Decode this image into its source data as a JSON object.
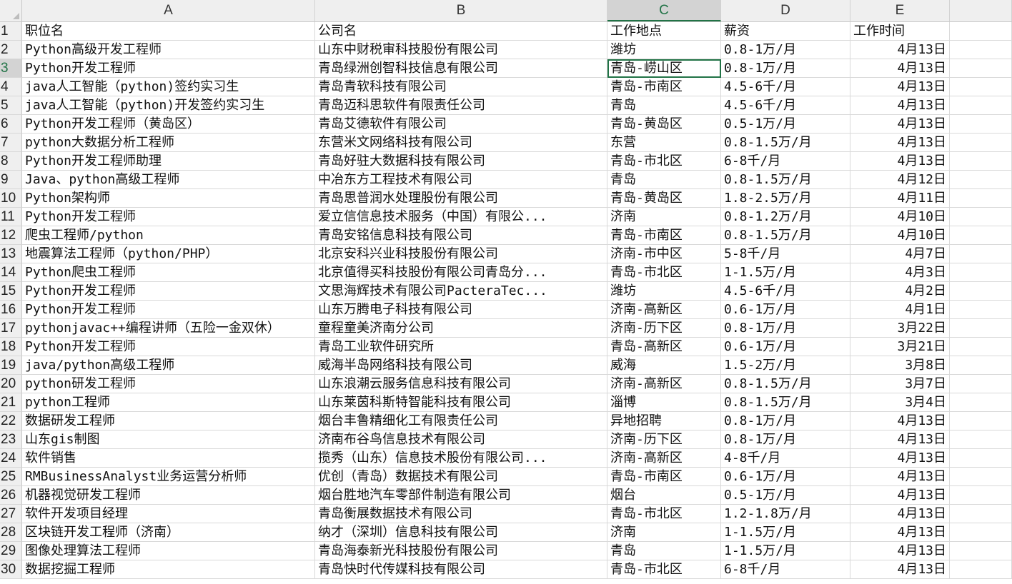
{
  "columns": [
    "A",
    "B",
    "C",
    "D",
    "E",
    ""
  ],
  "selected_column": 2,
  "active_cell": {
    "row": 3,
    "col": 2
  },
  "rows": [
    [
      "职位名",
      "公司名",
      "工作地点",
      "薪资",
      "工作时间"
    ],
    [
      "Python高级开发工程师",
      "山东中财税审科技股份有限公司",
      "潍坊",
      "0.8-1万/月",
      "4月13日"
    ],
    [
      "Python开发工程师",
      "青岛绿洲创智科技信息有限公司",
      "青岛-崂山区",
      "0.8-1万/月",
      "4月13日"
    ],
    [
      "java人工智能（python)签约实习生",
      "青岛青软科技有限公司",
      "青岛-市南区",
      "4.5-6千/月",
      "4月13日"
    ],
    [
      "java人工智能（python)开发签约实习生",
      "青岛迈科思软件有限责任公司",
      "青岛",
      "4.5-6千/月",
      "4月13日"
    ],
    [
      "Python开发工程师（黄岛区）",
      "青岛艾德软件有限公司",
      "青岛-黄岛区",
      "0.5-1万/月",
      "4月13日"
    ],
    [
      "python大数据分析工程师",
      "东营米文网络科技有限公司",
      "东营",
      "0.8-1.5万/月",
      "4月13日"
    ],
    [
      "Python开发工程师助理",
      "青岛好驻大数据科技有限公司",
      "青岛-市北区",
      "6-8千/月",
      "4月13日"
    ],
    [
      "Java、python高级工程师",
      "中冶东方工程技术有限公司",
      "青岛",
      "0.8-1.5万/月",
      "4月12日"
    ],
    [
      "Python架构师",
      "青岛思普润水处理股份有限公司",
      "青岛-黄岛区",
      "1.8-2.5万/月",
      "4月11日"
    ],
    [
      "Python开发工程师",
      "爱立信信息技术服务（中国）有限公...",
      "济南",
      "0.8-1.2万/月",
      "4月10日"
    ],
    [
      "爬虫工程师/python",
      "青岛安铭信息科技有限公司",
      "青岛-市南区",
      "0.8-1.5万/月",
      "4月10日"
    ],
    [
      "地震算法工程师（python/PHP）",
      "北京安科兴业科技股份有限公司",
      "济南-市中区",
      "5-8千/月",
      "4月7日"
    ],
    [
      "Python爬虫工程师",
      "北京值得买科技股份有限公司青岛分...",
      "青岛-市北区",
      "1-1.5万/月",
      "4月3日"
    ],
    [
      "Python开发工程师",
      "文思海辉技术有限公司PacteraTec...",
      "潍坊",
      "4.5-6千/月",
      "4月2日"
    ],
    [
      "Python开发工程师",
      "山东万腾电子科技有限公司",
      "济南-高新区",
      "0.6-1万/月",
      "4月1日"
    ],
    [
      "pythonjavac++编程讲师（五险一金双休）",
      "童程童美济南分公司",
      "济南-历下区",
      "0.8-1万/月",
      "3月22日"
    ],
    [
      "Python开发工程师",
      "青岛工业软件研究所",
      "青岛-高新区",
      "0.6-1万/月",
      "3月21日"
    ],
    [
      "java/python高级工程师",
      "威海半岛网络科技有限公司",
      "威海",
      "1.5-2万/月",
      "3月8日"
    ],
    [
      "python研发工程师",
      "山东浪潮云服务信息科技有限公司",
      "济南-高新区",
      "0.8-1.5万/月",
      "3月7日"
    ],
    [
      "python工程师",
      "山东莱茵科斯特智能科技有限公司",
      "淄博",
      "0.8-1.5万/月",
      "3月4日"
    ],
    [
      "数据研发工程师",
      "烟台丰鲁精细化工有限责任公司",
      "异地招聘",
      "0.8-1万/月",
      "4月13日"
    ],
    [
      "山东gis制图",
      "济南布谷鸟信息技术有限公司",
      "济南-历下区",
      "0.8-1万/月",
      "4月13日"
    ],
    [
      "软件销售",
      "揽秀（山东）信息技术股份有限公司...",
      "济南-高新区",
      "4-8千/月",
      "4月13日"
    ],
    [
      "RMBusinessAnalyst业务运营分析师",
      "优创（青岛）数据技术有限公司",
      "青岛-市南区",
      "0.6-1万/月",
      "4月13日"
    ],
    [
      "机器视觉研发工程师",
      "烟台胜地汽车零部件制造有限公司",
      "烟台",
      "0.5-1万/月",
      "4月13日"
    ],
    [
      "软件开发项目经理",
      "青岛衡展数据技术有限公司",
      "青岛-市北区",
      "1.2-1.8万/月",
      "4月13日"
    ],
    [
      "区块链开发工程师（济南）",
      "纳才（深圳）信息科技有限公司",
      "济南",
      "1-1.5万/月",
      "4月13日"
    ],
    [
      "图像处理算法工程师",
      "青岛海泰新光科技股份有限公司",
      "青岛",
      "1-1.5万/月",
      "4月13日"
    ],
    [
      "数据挖掘工程师",
      "青岛快时代传媒科技有限公司",
      "青岛-市北区",
      "6-8千/月",
      "4月13日"
    ]
  ]
}
